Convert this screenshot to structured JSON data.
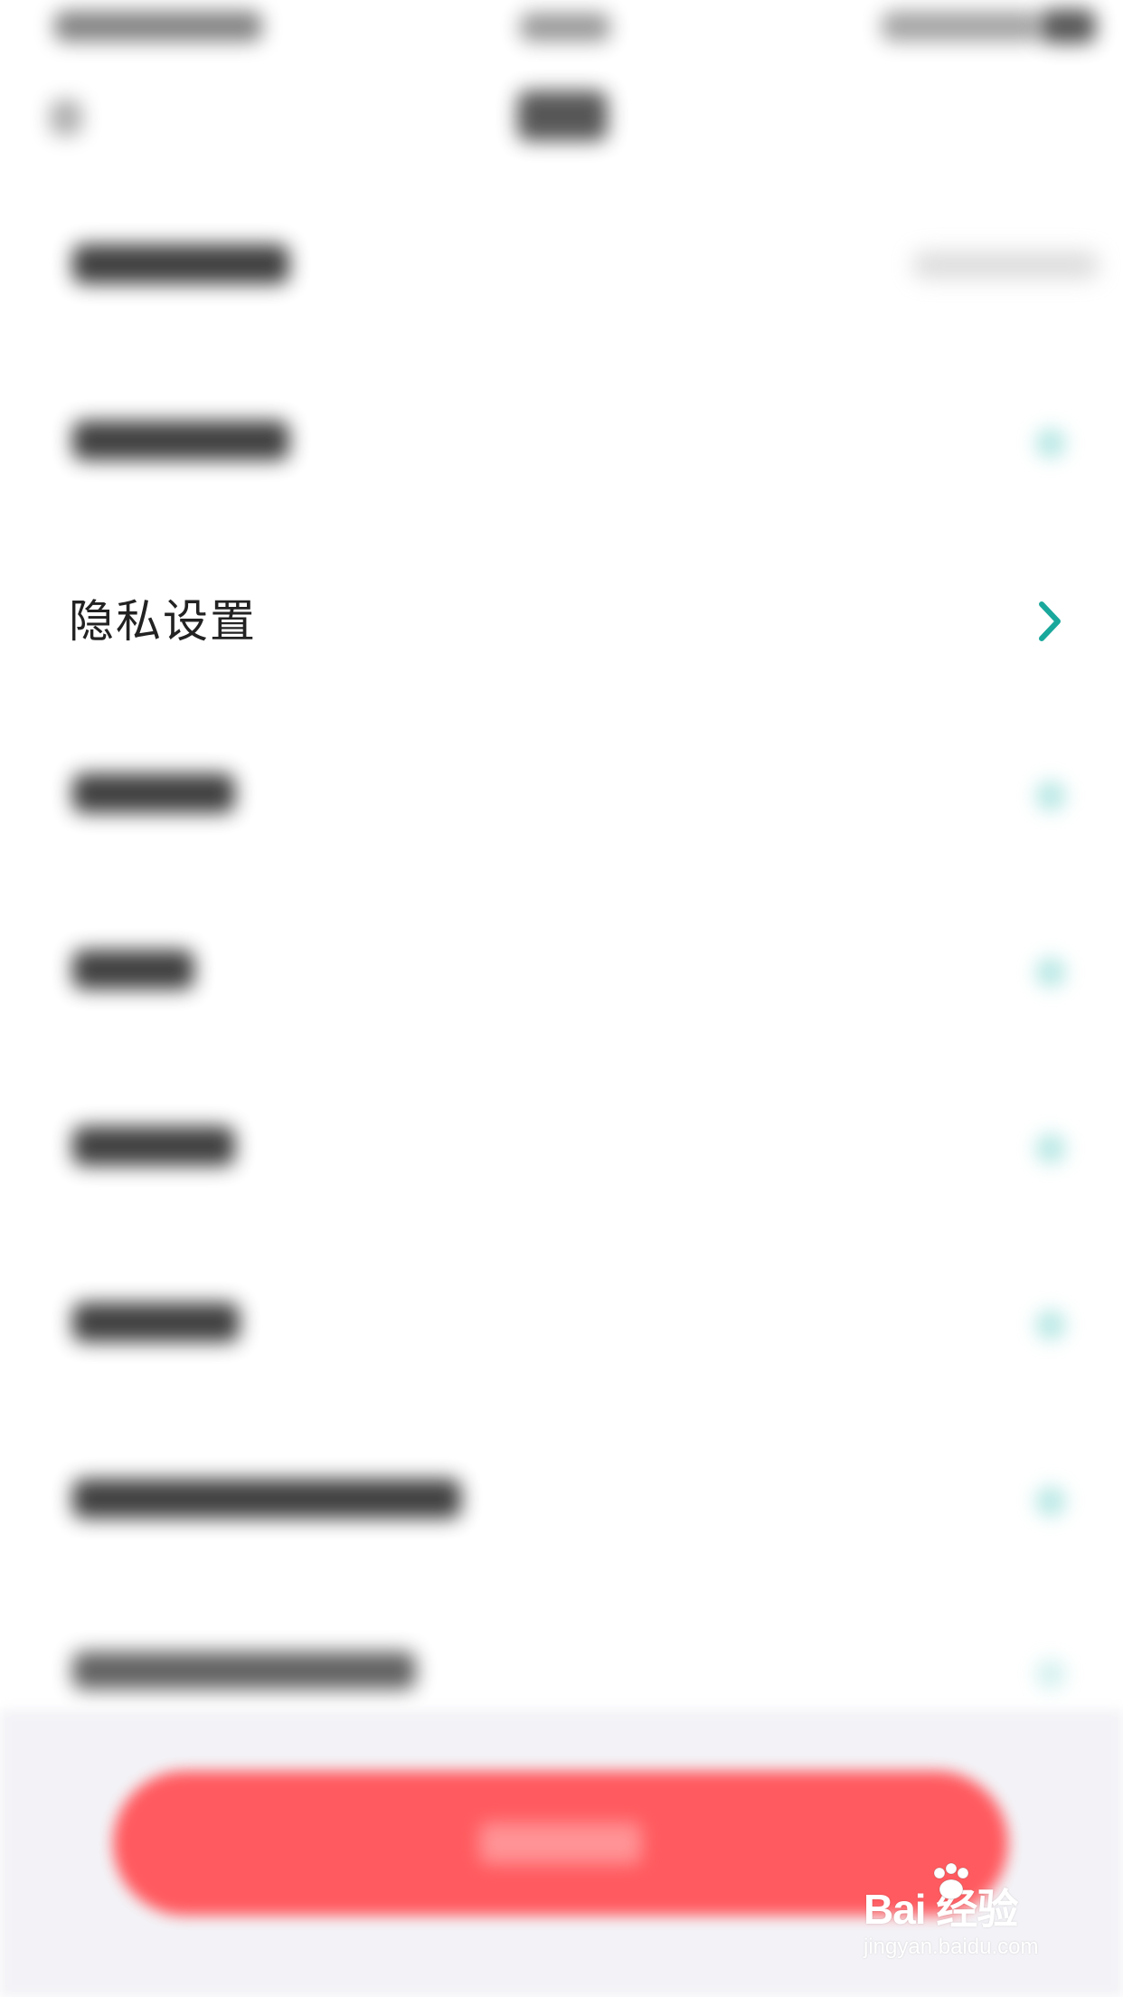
{
  "settings": {
    "privacy_label": "隐私设置",
    "accent_color": "#1aa89c",
    "chevron_icon": "chevron-right-icon"
  },
  "logout": {
    "button_color": "#ff5a5f"
  },
  "watermark": {
    "logo": "Bai  经验",
    "url": "jingyan.baidu.com"
  }
}
